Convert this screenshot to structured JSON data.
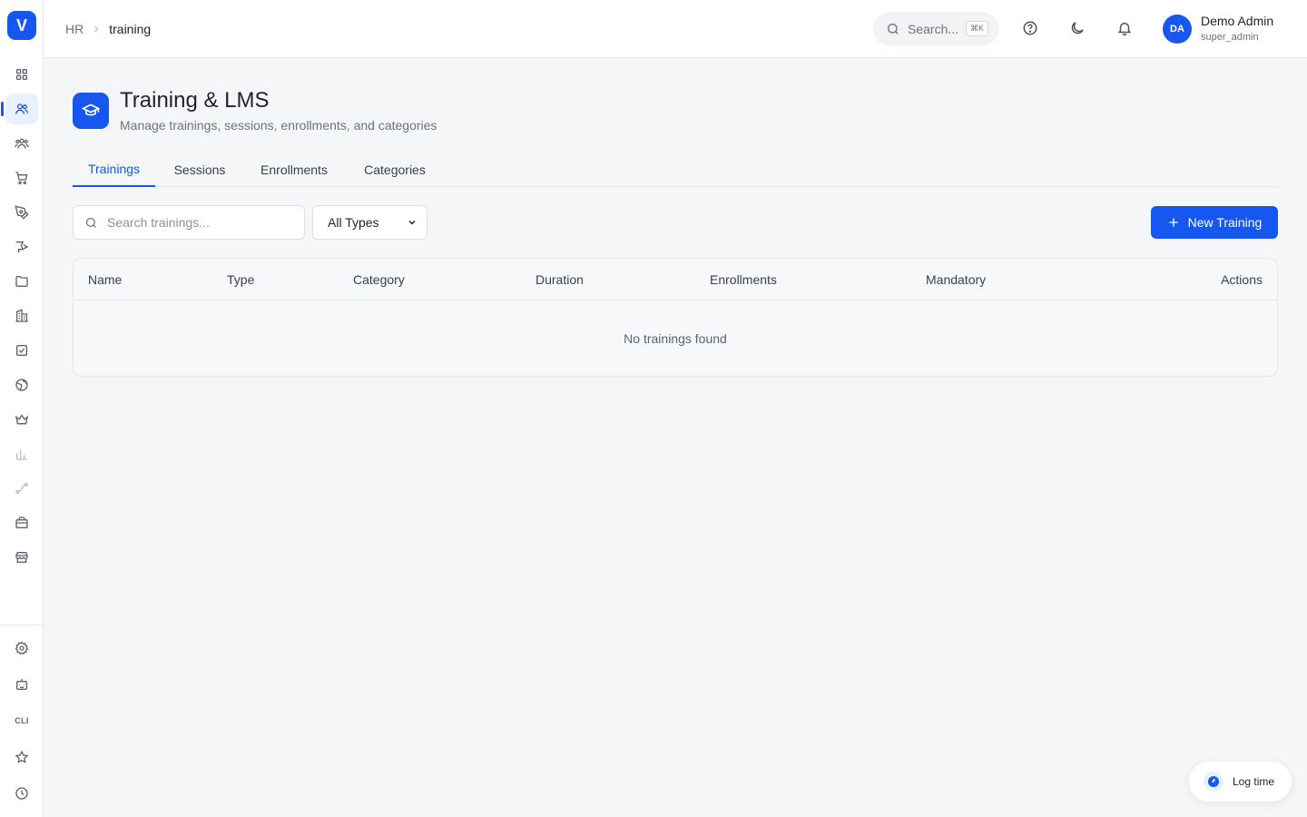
{
  "app": {
    "logo_letter": "V"
  },
  "sidebar": {
    "items": [
      {
        "icon": "dashboard-grid-icon"
      },
      {
        "icon": "users-icon",
        "active": true
      },
      {
        "icon": "team-icon"
      },
      {
        "icon": "cart-icon"
      },
      {
        "icon": "pen-icon"
      },
      {
        "icon": "campaign-icon"
      },
      {
        "icon": "folder-icon"
      },
      {
        "icon": "building-icon"
      },
      {
        "icon": "checkbox-icon"
      },
      {
        "icon": "globe-icon"
      },
      {
        "icon": "crown-icon"
      },
      {
        "icon": "bar-chart-icon",
        "faded": true
      },
      {
        "icon": "workflow-icon",
        "faded": true
      },
      {
        "icon": "briefcase-icon"
      },
      {
        "icon": "store-icon"
      }
    ],
    "bottom": [
      {
        "icon": "gear-icon"
      },
      {
        "icon": "bot-icon"
      },
      {
        "icon": "cli-icon",
        "label": "CLI"
      },
      {
        "icon": "star-icon"
      },
      {
        "icon": "clock-icon"
      }
    ]
  },
  "header": {
    "breadcrumb": {
      "root": "HR",
      "current": "training"
    },
    "search": {
      "placeholder": "Search...",
      "shortcut": "⌘K"
    },
    "user": {
      "initials": "DA",
      "name": "Demo Admin",
      "role": "super_admin"
    }
  },
  "page": {
    "title": "Training & LMS",
    "subtitle": "Manage trainings, sessions, enrollments, and categories",
    "tabs": [
      {
        "label": "Trainings",
        "active": true
      },
      {
        "label": "Sessions"
      },
      {
        "label": "Enrollments"
      },
      {
        "label": "Categories"
      }
    ]
  },
  "toolbar": {
    "search_placeholder": "Search trainings...",
    "type_filter": "All Types",
    "new_button": "New Training"
  },
  "table": {
    "columns": [
      "Name",
      "Type",
      "Category",
      "Duration",
      "Enrollments",
      "Mandatory",
      "Actions"
    ],
    "empty_message": "No trainings found"
  },
  "floating": {
    "log_time_label": "Log time"
  },
  "colors": {
    "accent": "#1557f0",
    "background": "#f5f6f8"
  }
}
